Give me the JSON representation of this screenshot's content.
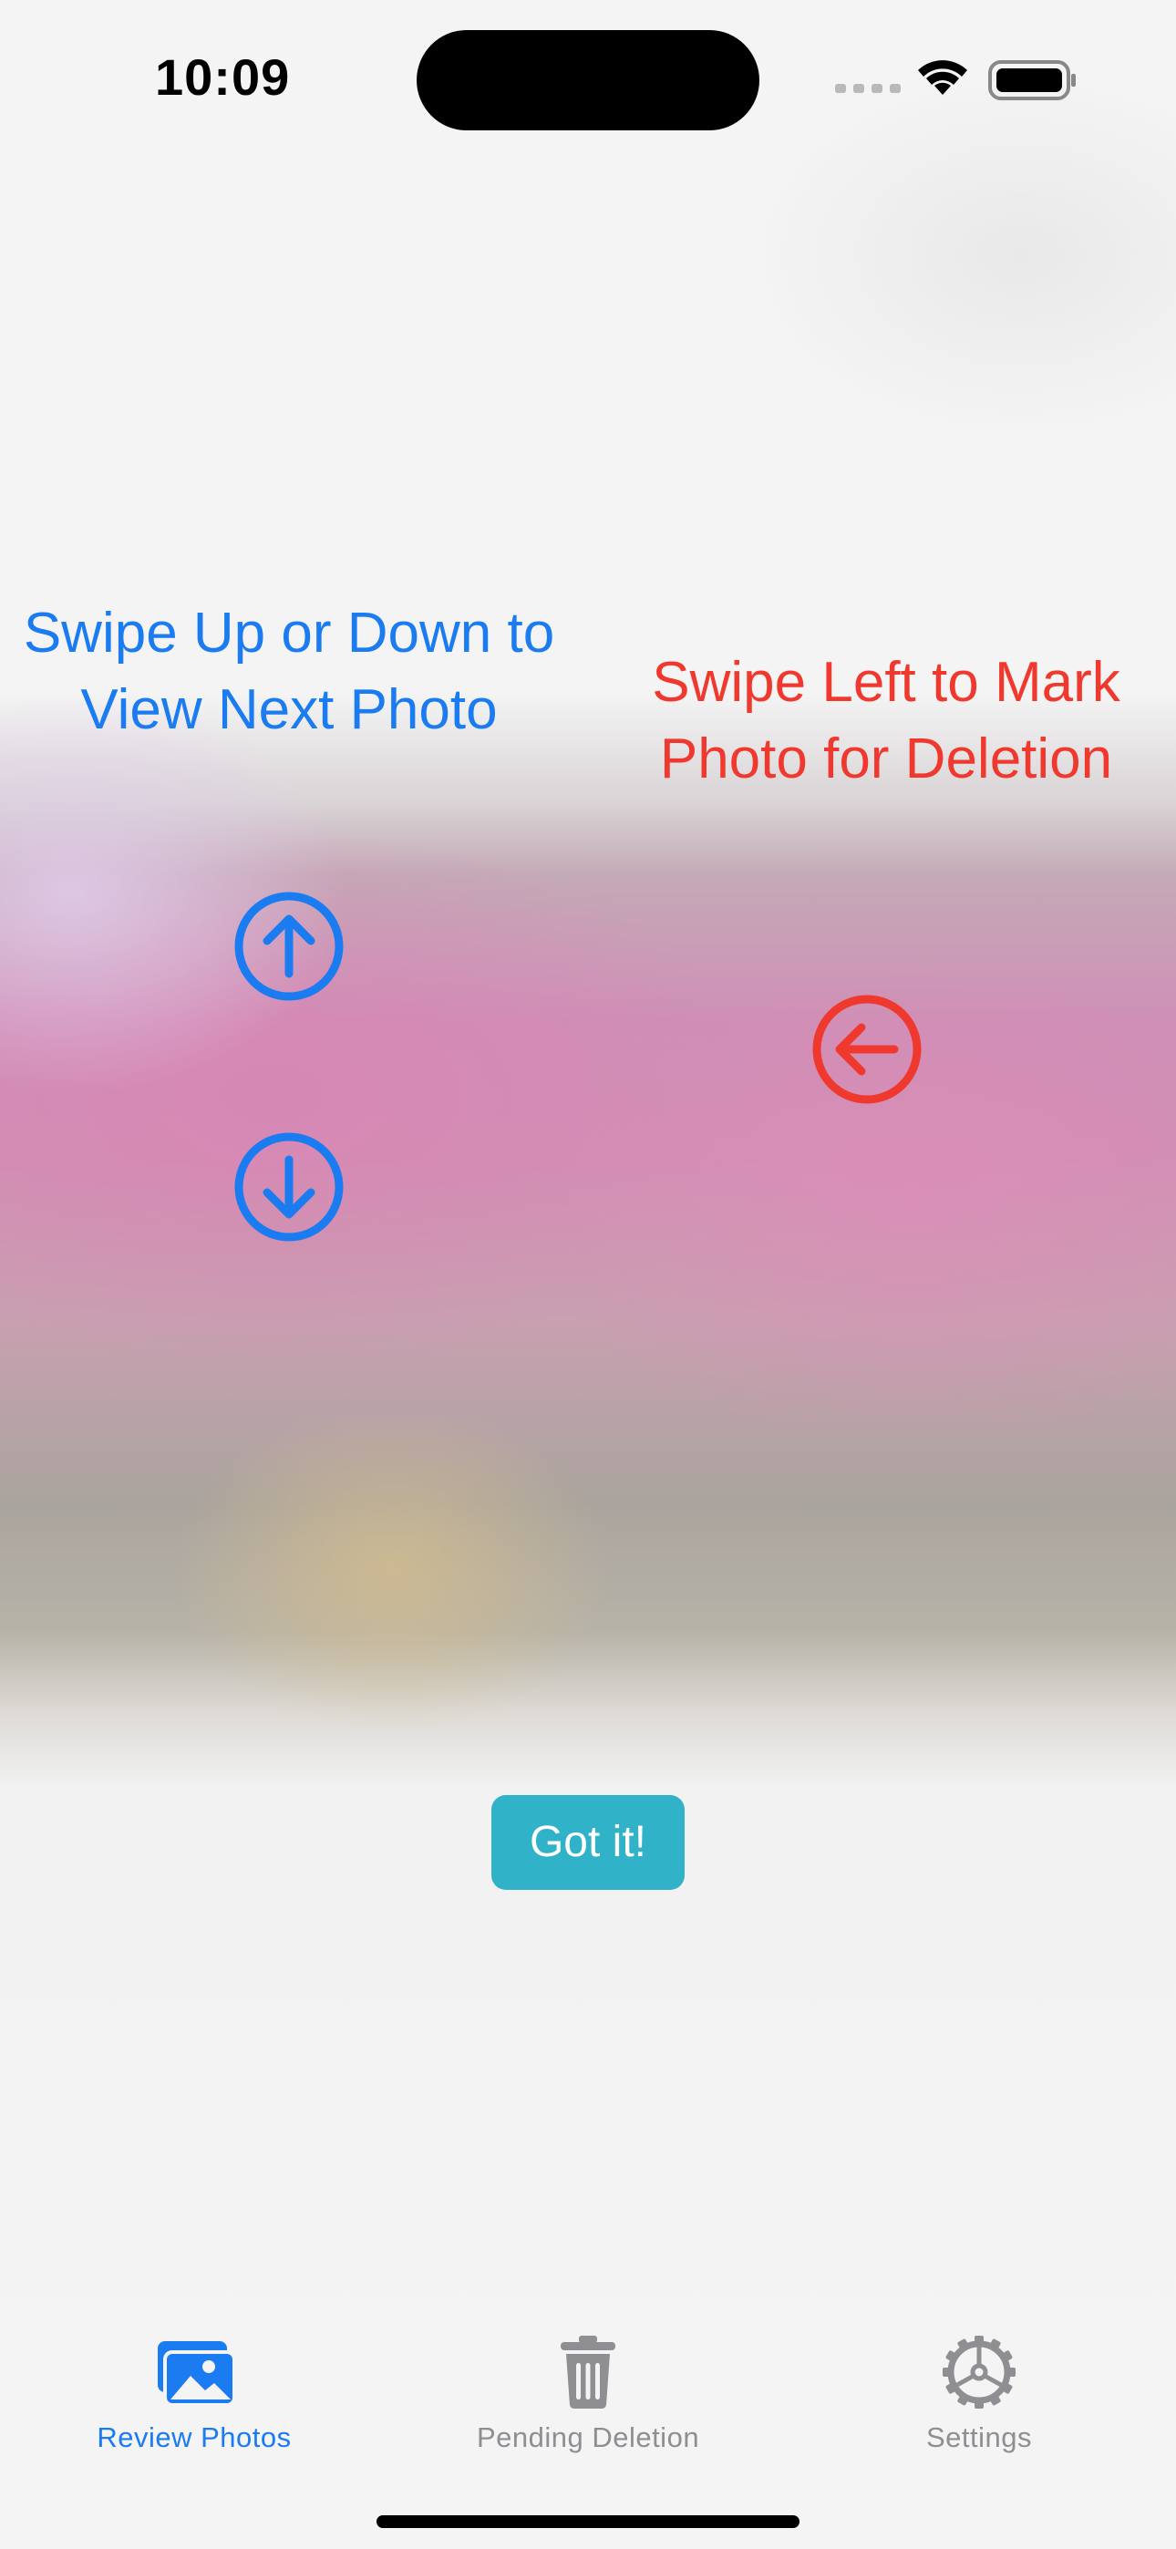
{
  "status_bar": {
    "time": "10:09"
  },
  "instructions": {
    "vertical": "Swipe Up or Down to View Next Photo",
    "left": "Swipe Left to Mark Photo for Deletion"
  },
  "icons": {
    "up": "arrow-up-circle-icon",
    "down": "arrow-down-circle-icon",
    "left": "arrow-left-circle-icon"
  },
  "confirm_button": {
    "label": "Got it!"
  },
  "tab_bar": {
    "tabs": [
      {
        "label": "Review Photos",
        "icon": "photo-stack-icon",
        "active": true
      },
      {
        "label": "Pending Deletion",
        "icon": "trash-icon",
        "active": false
      },
      {
        "label": "Settings",
        "icon": "gear-icon",
        "active": false
      }
    ]
  },
  "colors": {
    "blue": "#1b7bf0",
    "red": "#f0392e",
    "button": "#30b2c8",
    "inactive": "#8e8e93"
  }
}
